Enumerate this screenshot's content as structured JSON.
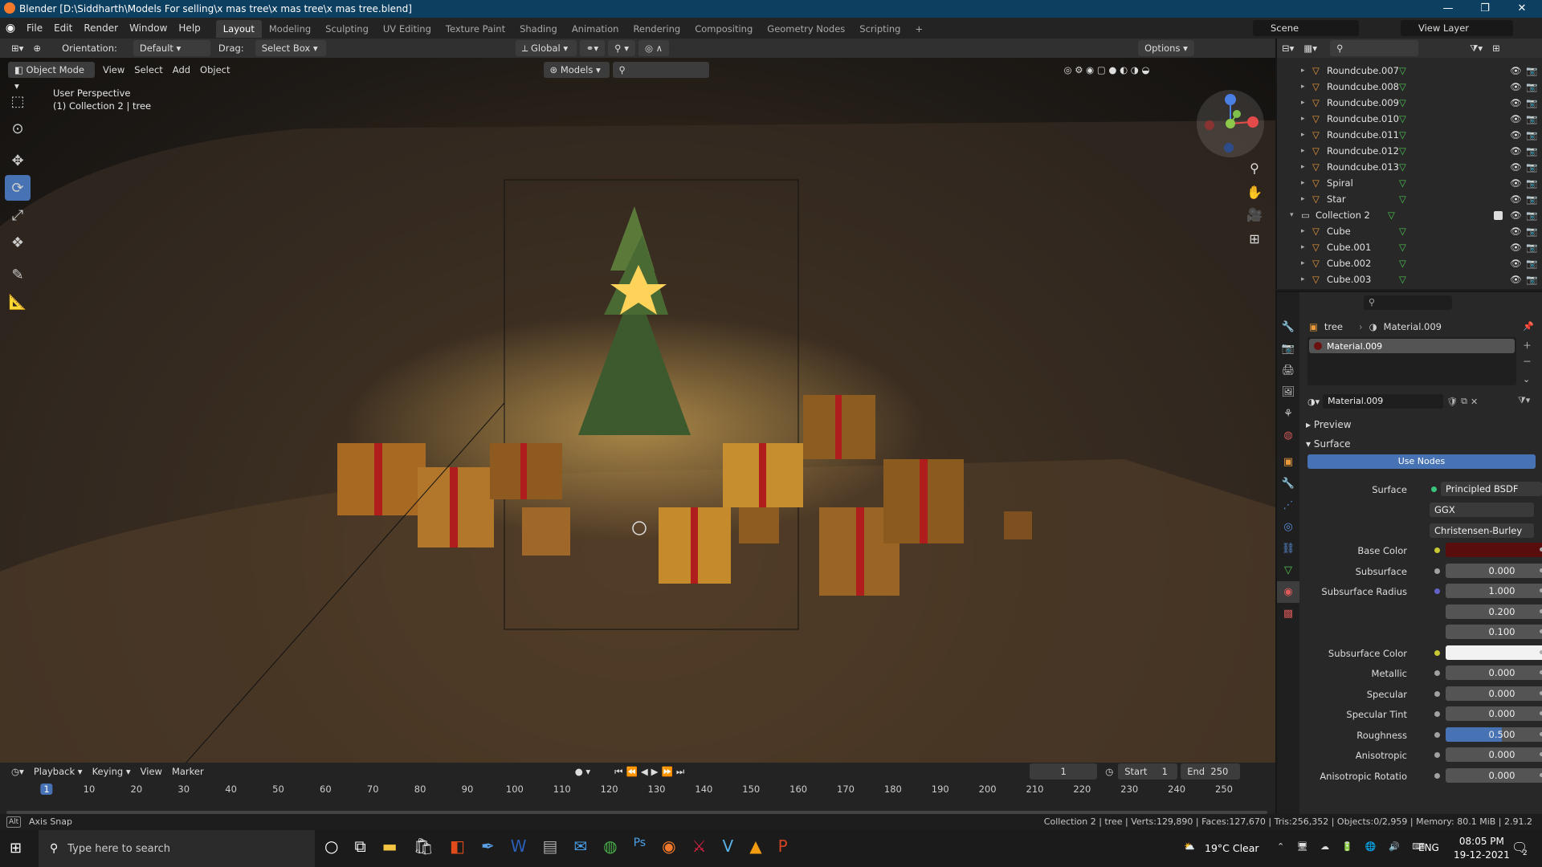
{
  "title_bar": {
    "title": "Blender [D:\\Siddharth\\Models For selling\\x mas tree\\x mas tree\\x mas tree.blend]"
  },
  "menu": [
    "File",
    "Edit",
    "Render",
    "Window",
    "Help"
  ],
  "workspaces": [
    "Layout",
    "Modeling",
    "Sculpting",
    "UV Editing",
    "Texture Paint",
    "Shading",
    "Animation",
    "Rendering",
    "Compositing",
    "Geometry Nodes",
    "Scripting"
  ],
  "active_workspace": "Layout",
  "scene": "Scene",
  "view_layer": "View Layer",
  "toolbar": {
    "orientation_label": "Orientation:",
    "orientation": "Default",
    "drag_label": "Drag:",
    "drag": "Select Box",
    "transform": "Global",
    "options": "Options"
  },
  "header": {
    "mode": "Object Mode",
    "view": "View",
    "select": "Select",
    "add": "Add",
    "object": "Object",
    "models": "Models"
  },
  "viewport": {
    "perspective": "User Perspective",
    "collection": "(1) Collection 2 | tree"
  },
  "outliner": {
    "items": [
      {
        "name": "Roundcube.007"
      },
      {
        "name": "Roundcube.008"
      },
      {
        "name": "Roundcube.009"
      },
      {
        "name": "Roundcube.010"
      },
      {
        "name": "Roundcube.011"
      },
      {
        "name": "Roundcube.012"
      },
      {
        "name": "Roundcube.013"
      },
      {
        "name": "Spiral"
      },
      {
        "name": "Star"
      },
      {
        "name": "Collection 2",
        "collection": true
      },
      {
        "name": "Cube"
      },
      {
        "name": "Cube.001"
      },
      {
        "name": "Cube.002"
      },
      {
        "name": "Cube.003"
      }
    ]
  },
  "properties": {
    "breadcrumb_object": "tree",
    "breadcrumb_material": "Material.009",
    "slot": "Material.009",
    "material": "Material.009",
    "preview": "Preview",
    "surface_section": "Surface",
    "use_nodes": "Use Nodes",
    "surface_label": "Surface",
    "surface_shader": "Principled BSDF",
    "distribution": "GGX",
    "subsurface_method": "Christensen-Burley",
    "fields": [
      {
        "label": "Base Color",
        "value": "",
        "color": "#5a0d0d",
        "dot": "#c8c832"
      },
      {
        "label": "Subsurface",
        "value": "0.000",
        "dot": "#a1a1a1"
      },
      {
        "label": "Subsurface Radius",
        "value": "1.000",
        "dot": "#6363c7"
      },
      {
        "label": "",
        "value": "0.200"
      },
      {
        "label": "",
        "value": "0.100"
      },
      {
        "label": "Subsurface Color",
        "value": "",
        "color": "#f2f2f2",
        "dot": "#c8c832"
      },
      {
        "label": "Metallic",
        "value": "0.000",
        "dot": "#a1a1a1"
      },
      {
        "label": "Specular",
        "value": "0.000",
        "dot": "#a1a1a1"
      },
      {
        "label": "Specular Tint",
        "value": "0.000",
        "dot": "#a1a1a1"
      },
      {
        "label": "Roughness",
        "value": "0.500",
        "dot": "#a1a1a1",
        "fill": 0.5
      },
      {
        "label": "Anisotropic",
        "value": "0.000",
        "dot": "#a1a1a1"
      },
      {
        "label": "Anisotropic Rotatio",
        "value": "0.000",
        "dot": "#a1a1a1"
      }
    ]
  },
  "timeline": {
    "playback": "Playback",
    "keying": "Keying",
    "view": "View",
    "marker": "Marker",
    "current_frame": "1",
    "start_label": "Start",
    "start": "1",
    "end_label": "End",
    "end": "250",
    "frame_ticks": [
      "1",
      "10",
      "20",
      "30",
      "40",
      "50",
      "60",
      "70",
      "80",
      "90",
      "100",
      "110",
      "120",
      "130",
      "140",
      "150",
      "160",
      "170",
      "180",
      "190",
      "200",
      "210",
      "220",
      "230",
      "240",
      "250"
    ]
  },
  "statusbar": {
    "left": "Axis Snap",
    "right": "Collection 2 | tree | Verts:129,890 | Faces:127,670 | Tris:256,352 | Objects:0/2,959 | Memory: 80.1 MiB | 2.91.2"
  },
  "taskbar": {
    "search_placeholder": "Type here to search",
    "weather": "19°C  Clear",
    "lang": "ENG",
    "time": "08:05 PM",
    "date": "19-12-2021",
    "notif_count": "2"
  }
}
